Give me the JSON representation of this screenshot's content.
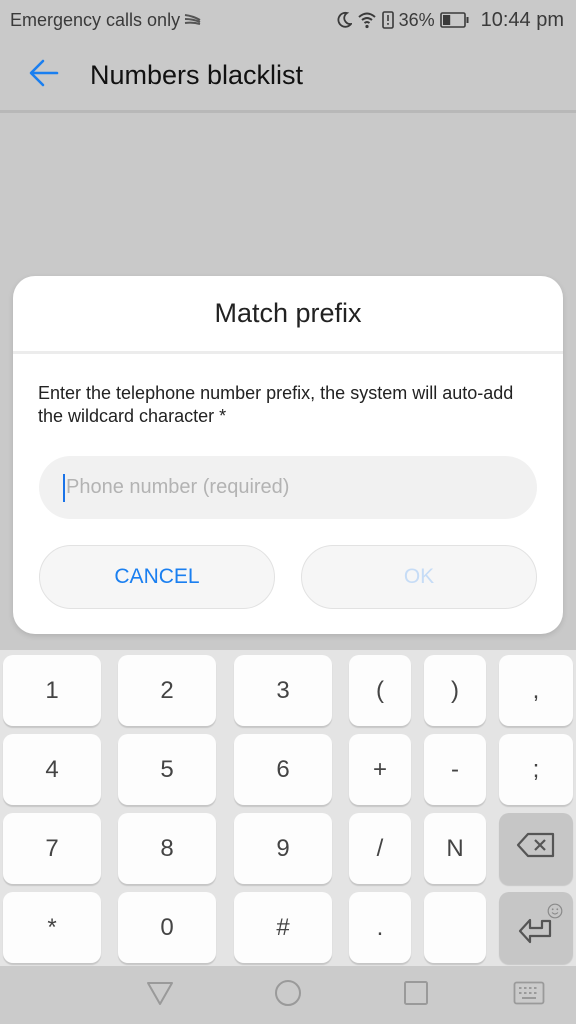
{
  "status_bar": {
    "carrier_text": "Emergency calls only",
    "icons": [
      "swiftkey-icon",
      "moon-icon",
      "wifi-icon",
      "battery-alert-icon",
      "battery-icon"
    ],
    "battery_percent": "36%",
    "battery_level": 0.36,
    "time": "10:44 pm"
  },
  "app_bar": {
    "back_icon": "arrow-left-icon",
    "title": "Numbers blacklist"
  },
  "dialog": {
    "title": "Match prefix",
    "message": "Enter the telephone number prefix, the system will auto-add the wildcard character *",
    "input": {
      "value": "",
      "placeholder": "Phone number (required)"
    },
    "cancel_label": "CANCEL",
    "ok_label": "OK",
    "ok_enabled": false
  },
  "keyboard": {
    "rows": [
      [
        "1",
        "2",
        "3",
        "(",
        ")",
        ","
      ],
      [
        "4",
        "5",
        "6",
        "+",
        "-",
        ";"
      ],
      [
        "7",
        "8",
        "9",
        "/",
        "N",
        "backspace"
      ],
      [
        "*",
        "0",
        "#",
        ".",
        "",
        "enter"
      ]
    ],
    "special_keys": {
      "backspace_icon": "backspace-icon",
      "enter_icon": "enter-icon",
      "emoji_hint_icon": "smiley-icon"
    }
  },
  "nav_bar": {
    "buttons": [
      "back-triangle-icon",
      "home-circle-icon",
      "recents-square-icon",
      "keyboard-icon"
    ]
  },
  "colors": {
    "accent": "#1a7ff0",
    "ok_disabled": "#c6dcf6",
    "dim_background": "#c9c9c9",
    "caret": "#1a73e8"
  }
}
